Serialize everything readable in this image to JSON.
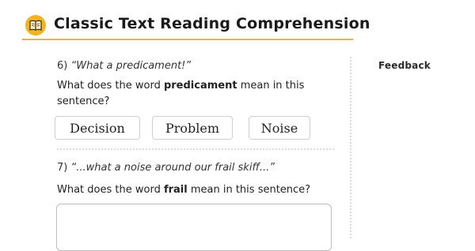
{
  "header": {
    "title": "Classic Text Reading Comprehension",
    "icon": "book-icon",
    "accent_color": "#f4b31c"
  },
  "questions": [
    {
      "number": "6)",
      "quote": "“What a predicament!”",
      "prompt_before": "What does the word ",
      "keyword": "predicament",
      "prompt_after": " mean in this sentence?",
      "choices": [
        "Decision",
        "Problem",
        "Noise"
      ]
    },
    {
      "number": "7)",
      "quote": "“...what a noise around our frail skiff...”",
      "prompt_before": "What does the word ",
      "keyword": "frail",
      "prompt_after": " mean in this sentence?",
      "answer_value": ""
    }
  ],
  "sidebar": {
    "feedback_label": "Feedback"
  }
}
